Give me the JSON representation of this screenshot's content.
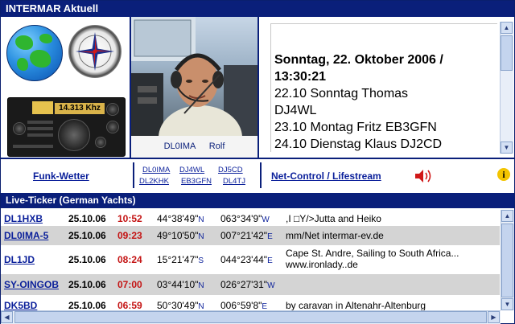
{
  "window": {
    "title": "INTERMAR Aktuell"
  },
  "radio": {
    "frequency": "14.313 Khz"
  },
  "photo": {
    "caption": "DL0IMA Rolf"
  },
  "news": {
    "date_line1": "Sonntag, 22. Oktober 2006 /",
    "date_line2": "13:30:21",
    "lines": [
      "22.10 Sonntag Thomas",
      "DJ4WL",
      "23.10 Montag Fritz EB3GFN",
      "24.10 Dienstag Klaus DJ2CD"
    ]
  },
  "links": {
    "funk_wetter": "Funk-Wetter",
    "net_control": "Net-Control / Lifestream",
    "callsigns": [
      "DL0IMA",
      "DJ4WL",
      "DJ5CD",
      "DL2KHK",
      "EB3GFN",
      "DL4TJ"
    ],
    "info_glyph": "i"
  },
  "ticker": {
    "title": "Live-Ticker (German Yachts)",
    "rows": [
      {
        "call": "DL1HXB",
        "date": "25.10.06",
        "time": "10:52",
        "time_red": true,
        "lat": "44°38'49\"",
        "lat_h": "N",
        "lon": "063°34'9\"",
        "lon_h": "W",
        "msg": ",I □Y/>Jutta and Heiko"
      },
      {
        "call": "DL0IMA-5",
        "date": "25.10.06",
        "time": "09:23",
        "time_red": true,
        "lat": "49°10'50\"",
        "lat_h": "N",
        "lon": "007°21'42\"",
        "lon_h": "E",
        "msg": "mm/Net intermar-ev.de"
      },
      {
        "call": "DL1JD",
        "date": "25.10.06",
        "time": "08:24",
        "time_red": true,
        "lat": "15°21'47\"",
        "lat_h": "S",
        "lon": "044°23'44\"",
        "lon_h": "E",
        "msg": "Cape St. Andre, Sailing to South Africa... www.ironlady..de"
      },
      {
        "call": "SY-OINGOB",
        "date": "25.10.06",
        "time": "07:00",
        "time_red": true,
        "lat": "03°44'10\"",
        "lat_h": "N",
        "lon": "026°27'31\"",
        "lon_h": "W",
        "msg": ""
      },
      {
        "call": "DK5BD",
        "date": "25.10.06",
        "time": "06:59",
        "time_red": true,
        "lat": "50°30'49\"",
        "lat_h": "N",
        "lon": "006°59'8\"",
        "lon_h": "E",
        "msg": "by caravan in Altenahr-Altenburg"
      }
    ]
  },
  "colors": {
    "navy": "#0a1f7a",
    "link": "#0a1f9a",
    "time_red": "#c41414",
    "row_alt": "#d4d4d4"
  }
}
